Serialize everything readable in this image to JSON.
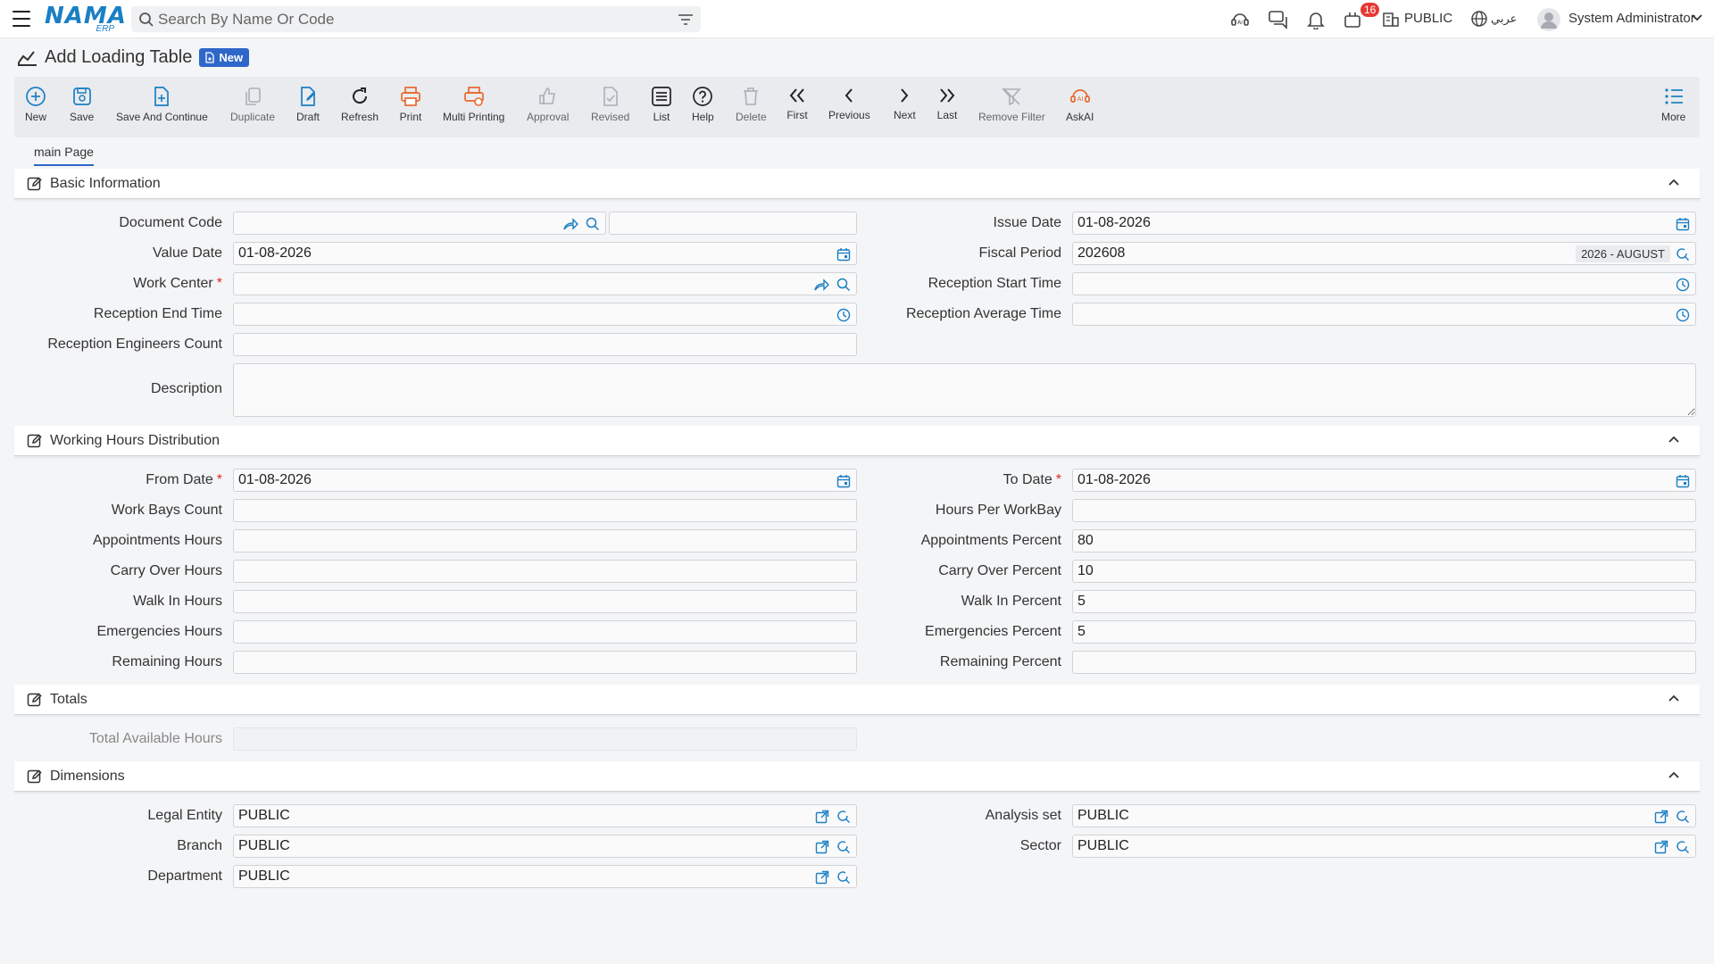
{
  "header": {
    "logo_text": "NAMA",
    "logo_sub": "ERP",
    "search_placeholder": "Search By Name Or Code",
    "notification_count": "16",
    "company": "PUBLIC",
    "language": "عربي",
    "user": "System Administrator"
  },
  "page": {
    "title": "Add Loading Table",
    "status_badge": "New"
  },
  "toolbar": {
    "new": "New",
    "save": "Save",
    "save_continue": "Save And Continue",
    "duplicate": "Duplicate",
    "draft": "Draft",
    "refresh": "Refresh",
    "print": "Print",
    "multi_printing": "Multi Printing",
    "approval": "Approval",
    "revised": "Revised",
    "list": "List",
    "help": "Help",
    "delete": "Delete",
    "first": "First",
    "previous": "Previous",
    "next": "Next",
    "last": "Last",
    "remove_filter": "Remove Filter",
    "askai": "AskAI",
    "more": "More"
  },
  "tabs": {
    "main": "main Page"
  },
  "basic": {
    "title": "Basic Information",
    "document_code_label": "Document Code",
    "document_code": "",
    "document_code_extra": "",
    "issue_date_label": "Issue Date",
    "issue_date": "01-08-2026",
    "value_date_label": "Value Date",
    "value_date": "01-08-2026",
    "fiscal_period_label": "Fiscal Period",
    "fiscal_period": "202608",
    "fiscal_period_desc": "2026 - AUGUST",
    "work_center_label": "Work Center",
    "work_center": "",
    "reception_start_label": "Reception Start Time",
    "reception_start": "",
    "reception_end_label": "Reception End Time",
    "reception_end": "",
    "reception_avg_label": "Reception Average Time",
    "reception_avg": "",
    "engineers_count_label": "Reception Engineers Count",
    "engineers_count": "",
    "description_label": "Description",
    "description": ""
  },
  "working": {
    "title": "Working Hours Distribution",
    "from_date_label": "From Date",
    "from_date": "01-08-2026",
    "to_date_label": "To Date",
    "to_date": "01-08-2026",
    "work_bays_label": "Work Bays Count",
    "work_bays": "",
    "hours_per_bay_label": "Hours Per WorkBay",
    "hours_per_bay": "",
    "appointments_hours_label": "Appointments Hours",
    "appointments_hours": "",
    "appointments_percent_label": "Appointments Percent",
    "appointments_percent": "80",
    "carry_hours_label": "Carry Over Hours",
    "carry_hours": "",
    "carry_percent_label": "Carry Over Percent",
    "carry_percent": "10",
    "walkin_hours_label": "Walk In Hours",
    "walkin_hours": "",
    "walkin_percent_label": "Walk In Percent",
    "walkin_percent": "5",
    "emerg_hours_label": "Emergencies Hours",
    "emerg_hours": "",
    "emerg_percent_label": "Emergencies Percent",
    "emerg_percent": "5",
    "remaining_hours_label": "Remaining Hours",
    "remaining_hours": "",
    "remaining_percent_label": "Remaining Percent",
    "remaining_percent": ""
  },
  "totals": {
    "title": "Totals",
    "total_available_label": "Total Available Hours",
    "total_available": ""
  },
  "dimensions": {
    "title": "Dimensions",
    "legal_entity_label": "Legal Entity",
    "legal_entity": "PUBLIC",
    "analysis_set_label": "Analysis set",
    "analysis_set": "PUBLIC",
    "branch_label": "Branch",
    "branch": "PUBLIC",
    "sector_label": "Sector",
    "sector": "PUBLIC",
    "department_label": "Department",
    "department": "PUBLIC"
  },
  "colors": {
    "accent": "#2f67c9",
    "icon_blue": "#1a7fc4",
    "print_orange": "#e8692e",
    "required": "#d93025",
    "badge_red": "#e53935"
  }
}
